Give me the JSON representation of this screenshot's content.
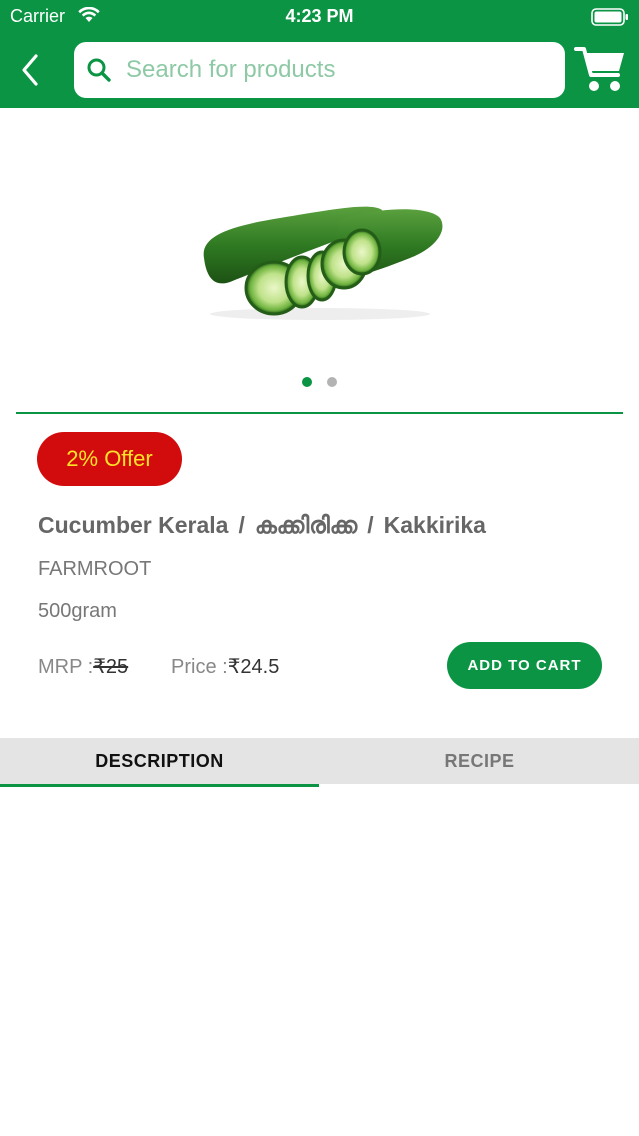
{
  "status_bar": {
    "carrier": "Carrier",
    "time": "4:23 PM"
  },
  "nav": {
    "search_placeholder": "Search for products",
    "icons": [
      "back-chevron-icon",
      "search-icon",
      "cart-icon"
    ]
  },
  "gallery": {
    "image": "cucumber-image",
    "page_count": 2,
    "active_page": 1
  },
  "product": {
    "offer": "2% Offer",
    "name_en": "Cucumber Kerala",
    "name_sep1": "/",
    "name_ml": "കക്കിരിക്ക",
    "name_sep2": "/",
    "name_translit": "Kakkirika",
    "brand": "FARMROOT",
    "weight": "500gram",
    "mrp_label": "MRP :",
    "mrp_value": "₹25",
    "price_label": "Price :",
    "price_value": "₹24.5",
    "add_to_cart": "ADD TO CART"
  },
  "tabs": {
    "description": "DESCRIPTION",
    "recipe": "RECIPE",
    "active": "description"
  },
  "colors": {
    "brand_green": "#0a9444",
    "offer_red": "#d20c0c",
    "offer_text": "#ffe229",
    "tab_bg": "#e4e4e4"
  }
}
